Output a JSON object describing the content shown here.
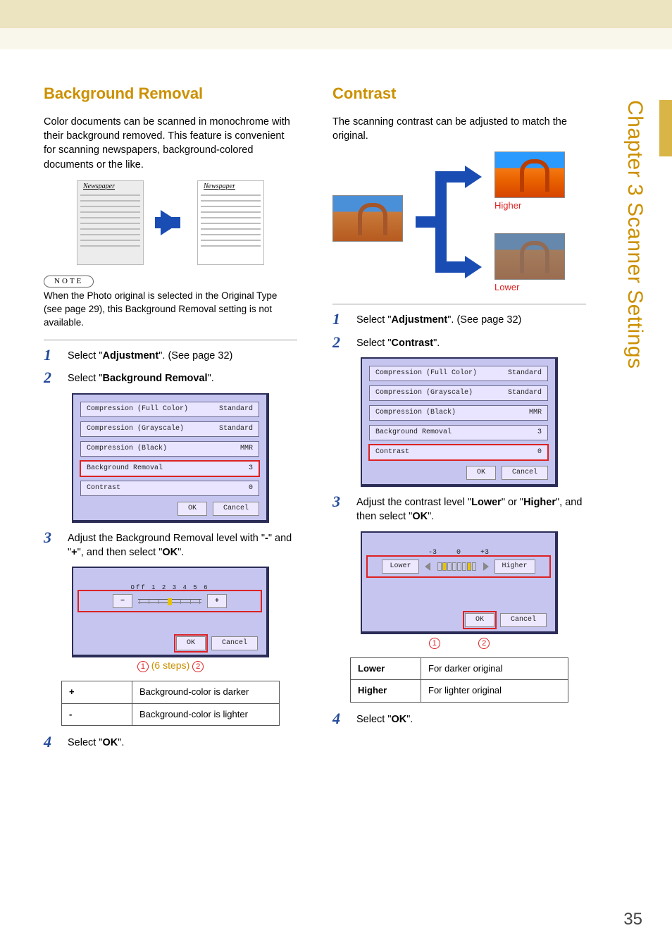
{
  "page_number": "35",
  "side_tab": "Chapter 3    Scanner Settings",
  "left": {
    "title": "Background Removal",
    "intro": "Color documents can be scanned in monochrome with their background removed. This feature is convenient for scanning newspapers, background-colored documents or the like.",
    "newspaper_label": "Newspaper",
    "note_label": "NOTE",
    "note_text": "When the Photo original is selected in the Original Type (see page 29), this Background Removal setting is not available.",
    "step1_pre": "Select \"",
    "step1_bold": "Adjustment",
    "step1_post": "\". (See page 32)",
    "step2_pre": "Select \"",
    "step2_bold": "Background Removal",
    "step2_post": "\".",
    "step3": "Adjust the Background Removal level with \"-\" and \"+\", and then select \"OK\".",
    "step4_pre": "Select \"",
    "step4_bold": "OK",
    "step4_post": "\".",
    "lcd": {
      "r1l": "Compression (Full Color)",
      "r1v": "Standard",
      "r2l": "Compression (Grayscale)",
      "r2v": "Standard",
      "r3l": "Compression (Black)",
      "r3v": "MMR",
      "r4l": "Background Removal",
      "r4v": "3",
      "r5l": "Contrast",
      "r5v": "0",
      "ok": "OK",
      "cancel": "Cancel"
    },
    "slider": {
      "labels": "Off 1  2  3  4  5  6",
      "minus": "−",
      "plus": "+",
      "ok": "OK",
      "cancel": "Cancel"
    },
    "caption_mid": "(6 steps)",
    "table": {
      "h1": "+",
      "v1": "Background-color is darker",
      "h2": "-",
      "v2": "Background-color is lighter"
    }
  },
  "right": {
    "title": "Contrast",
    "intro": "The scanning contrast can be adjusted to match the original.",
    "higher": "Higher",
    "lower": "Lower",
    "step1_pre": "Select \"",
    "step1_bold": "Adjustment",
    "step1_post": "\". (See page 32)",
    "step2_pre": "Select \"",
    "step2_bold": "Contrast",
    "step2_post": "\".",
    "step3_a": "Adjust the contrast level \"",
    "step3_b": "Lower",
    "step3_c": "\" or \"",
    "step3_d": "Higher",
    "step3_e": "\", and then select \"",
    "step3_f": "OK",
    "step3_g": "\".",
    "step4_pre": "Select \"",
    "step4_bold": "OK",
    "step4_post": "\".",
    "lcd": {
      "r1l": "Compression (Full Color)",
      "r1v": "Standard",
      "r2l": "Compression (Grayscale)",
      "r2v": "Standard",
      "r3l": "Compression (Black)",
      "r3v": "MMR",
      "r4l": "Background Removal",
      "r4v": "3",
      "r5l": "Contrast",
      "r5v": "0",
      "ok": "OK",
      "cancel": "Cancel"
    },
    "slider": {
      "m3": "-3",
      "z": "0",
      "p3": "+3",
      "lower_btn": "Lower",
      "higher_btn": "Higher",
      "ok": "OK",
      "cancel": "Cancel"
    },
    "table": {
      "h1": "Lower",
      "v1": "For darker original",
      "h2": "Higher",
      "v2": "For lighter original"
    }
  }
}
